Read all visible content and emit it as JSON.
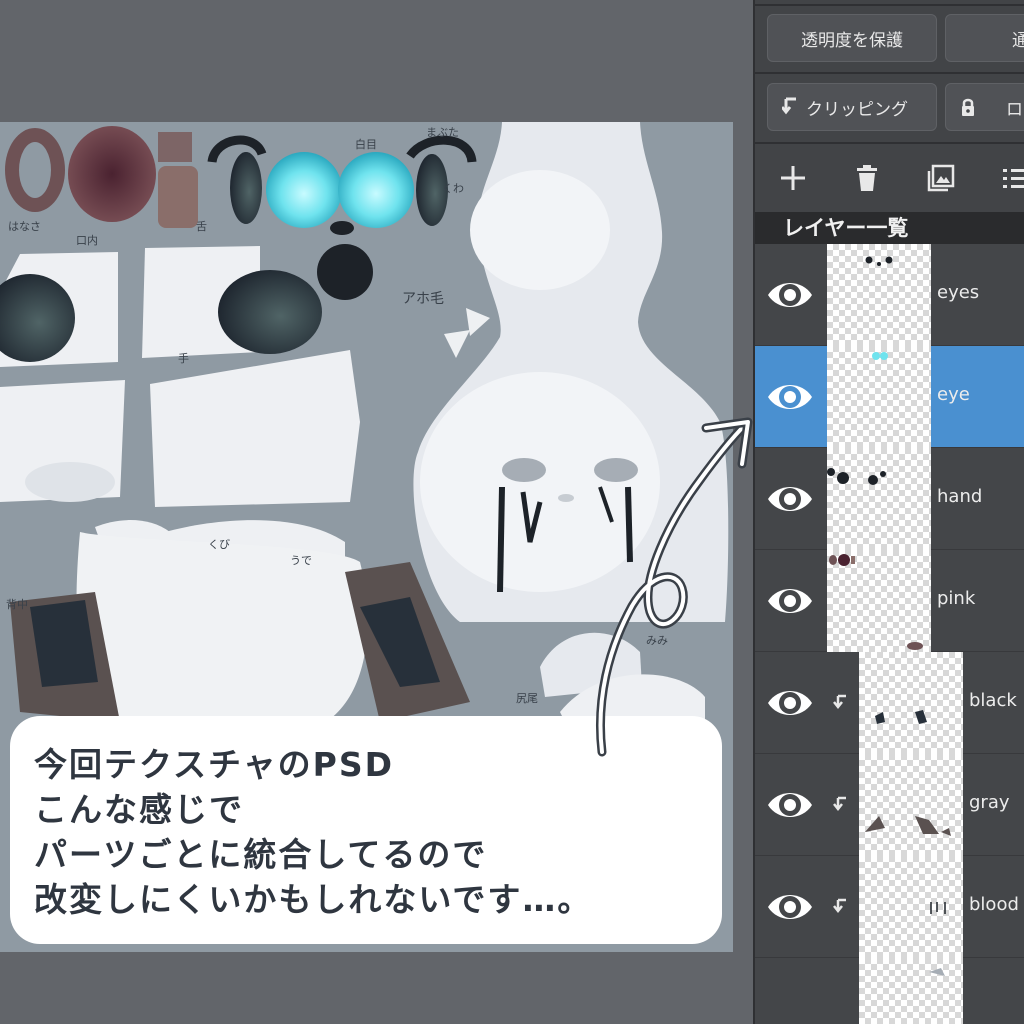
{
  "toolbar": {
    "protect_alpha_label": "透明度を保護",
    "second_top_label": "通",
    "clipping_label": "クリッピング",
    "lock_label": "ロ"
  },
  "layer_panel": {
    "title": "レイヤー一覧",
    "layers": [
      {
        "name": "eyes",
        "selected": false,
        "clipped": false
      },
      {
        "name": "eye",
        "selected": true,
        "clipped": false
      },
      {
        "name": "hand",
        "selected": false,
        "clipped": false
      },
      {
        "name": "pink",
        "selected": false,
        "clipped": false
      },
      {
        "name": "black",
        "selected": false,
        "clipped": true
      },
      {
        "name": "gray",
        "selected": false,
        "clipped": true
      },
      {
        "name": "blood",
        "selected": false,
        "clipped": true
      }
    ]
  },
  "caption": {
    "lines": [
      "今回テクスチャのPSD",
      "こんな感じで",
      "パーツごとに統合してるので",
      "改変しにくいかもしれないです…。"
    ]
  },
  "texture_labels": {
    "l1": "白目",
    "l2": "まぶた",
    "l3": "くわ",
    "l4": "アホ毛",
    "l5": "はなさ",
    "l6": "口内",
    "l7": "舌",
    "l8": "手",
    "l9": "くび",
    "l10": "うで",
    "l11": "背中",
    "l12": "みみ",
    "l13": "尻尾"
  },
  "colors": {
    "selected_layer": "#4a90d0",
    "panel_bg": "#424447",
    "canvas_bg": "#8f9aa3",
    "eye_glow": "#6fe3ee",
    "caption_text": "#2f3640"
  }
}
